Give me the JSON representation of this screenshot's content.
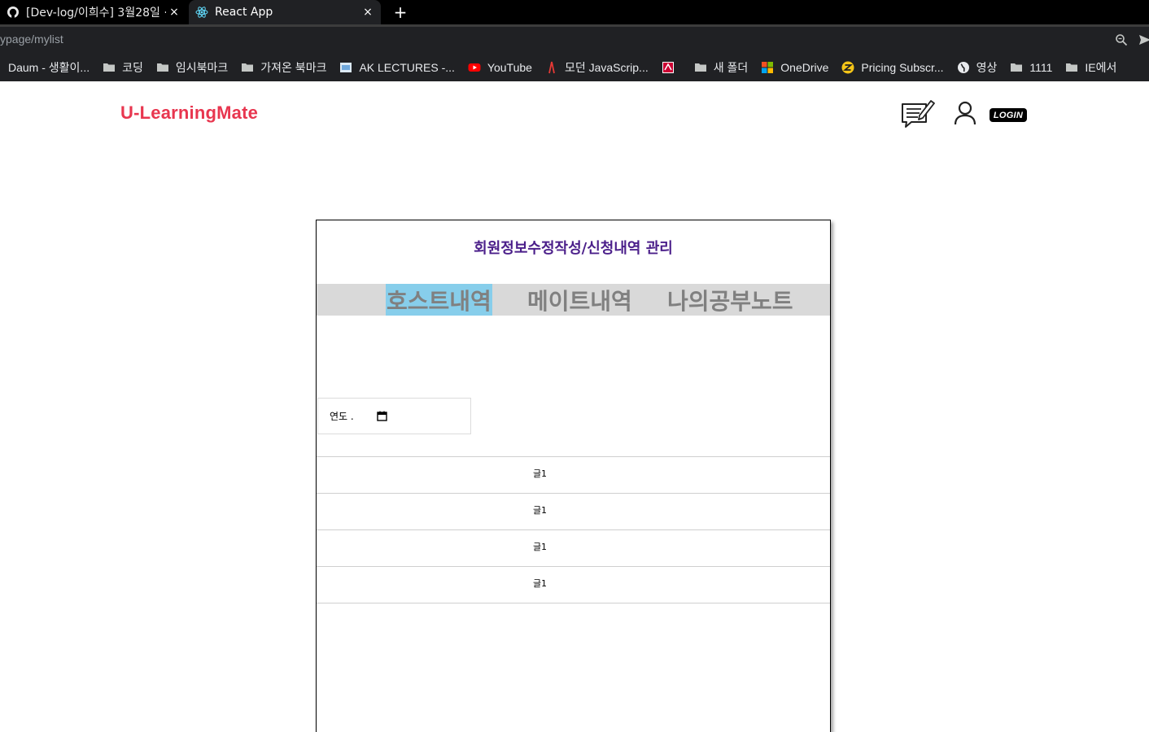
{
  "browser": {
    "tabs": [
      {
        "title": "[Dev-log/이희수] 3월28일 ·",
        "active": false,
        "icon": "github-icon"
      },
      {
        "title": "React App",
        "active": true,
        "icon": "react-icon"
      }
    ],
    "new_tab_label": "+",
    "close_glyph": "×",
    "url": "ypage/mylist",
    "bookmarks": [
      {
        "label": "Daum - 생활이...",
        "icon": "daum-icon"
      },
      {
        "label": "코딩",
        "icon": "folder-icon"
      },
      {
        "label": "임시북마크",
        "icon": "folder-icon"
      },
      {
        "label": "가져온 북마크",
        "icon": "folder-icon"
      },
      {
        "label": "AK LECTURES -...",
        "icon": "ak-lectures-icon"
      },
      {
        "label": "YouTube",
        "icon": "youtube-icon"
      },
      {
        "label": "모던 JavaScrip...",
        "icon": "javascript-icon"
      },
      {
        "label": "",
        "icon": "rutgers-icon"
      },
      {
        "label": "새 폴더",
        "icon": "folder-icon"
      },
      {
        "label": "OneDrive",
        "icon": "microsoft-icon"
      },
      {
        "label": "Pricing Subscr...",
        "icon": "pricing-icon"
      },
      {
        "label": "영상",
        "icon": "globe-icon"
      },
      {
        "label": "1111",
        "icon": "folder-icon"
      },
      {
        "label": "IE에서",
        "icon": "folder-icon"
      }
    ]
  },
  "header": {
    "logo": "U-LearningMate",
    "login_label": "LOGIN"
  },
  "card": {
    "title": "회원정보수정작성/신청내역 관리",
    "tabs": [
      {
        "label": "호스트내역",
        "selected": true
      },
      {
        "label": "메이트내역",
        "selected": false
      },
      {
        "label": "나의공부노트",
        "selected": false
      }
    ],
    "date_input_text": "연도 .",
    "posts": [
      "글1",
      "글1",
      "글1",
      "글1"
    ]
  },
  "colors": {
    "logo": "#e8364f",
    "card_title": "#4b1f8a",
    "tab_bar": "#d9d9d9",
    "tab_selected": "#87ceeb",
    "tab_text": "#808080"
  }
}
